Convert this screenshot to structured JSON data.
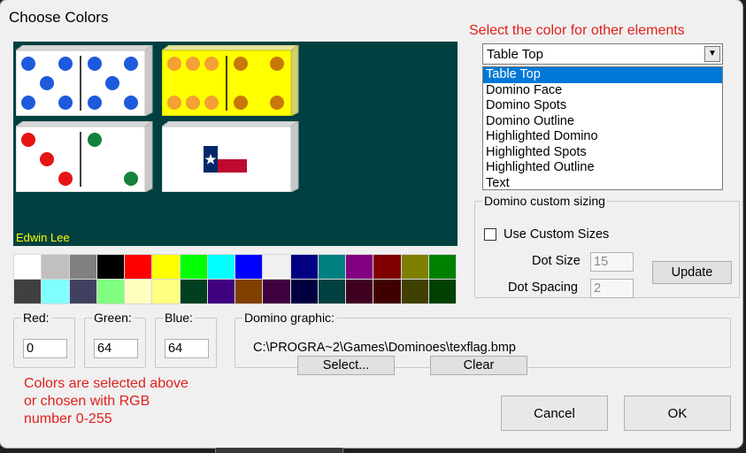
{
  "window": {
    "title": "Choose Colors"
  },
  "hints": {
    "element_select": "Select the color for other elements",
    "rgb_info": "Colors are selected above or chosen with RGB number 0-255"
  },
  "preview": {
    "credit": "Edwin Lee",
    "background": "#004040"
  },
  "palette": {
    "colors": [
      "#ffffff",
      "#c0c0c0",
      "#808080",
      "#000000",
      "#ff0000",
      "#ffff00",
      "#00ff00",
      "#00ffff",
      "#0000ff",
      "#f0f0f0",
      "#000080",
      "#008080",
      "#800080",
      "#800000",
      "#808000",
      "#008000",
      "#404040",
      "#80ffff",
      "#404060",
      "#80ff80",
      "#ffffc0",
      "#ffff80",
      "#004020",
      "#400080",
      "#804000",
      "#400040",
      "#000040",
      "#004040",
      "#400020",
      "#400000",
      "#404000",
      "#004000"
    ]
  },
  "element_selector": {
    "selected": "Table Top",
    "options": [
      "Table Top",
      "Domino Face",
      "Domino Spots",
      "Domino Outline",
      "Highlighted Domino",
      "Highlighted Spots",
      "Highlighted Outline",
      "Text"
    ]
  },
  "custom_sizing": {
    "legend": "Domino custom sizing",
    "checkbox_label": "Use Custom Sizes",
    "dot_size_label": "Dot Size",
    "dot_size_value": "15",
    "dot_spacing_label": "Dot Spacing",
    "dot_spacing_value": "2",
    "update_label": "Update"
  },
  "rgb": {
    "red_label": "Red:",
    "red_value": "0",
    "green_label": "Green:",
    "green_value": "64",
    "blue_label": "Blue:",
    "blue_value": "64"
  },
  "graphic": {
    "legend": "Domino graphic:",
    "path": "C:\\PROGRA~2\\Games\\Dominoes\\texflag.bmp",
    "select_label": "Select...",
    "clear_label": "Clear"
  },
  "buttons": {
    "cancel": "Cancel",
    "ok": "OK"
  },
  "colors": {
    "hint_red": "#e0201b",
    "credit_yellow": "#ffff00",
    "selection_blue": "#0078d7",
    "spot_blue": "#1e5adc",
    "spot_red": "#e61414",
    "spot_green": "#14823c",
    "highlight_face": "#ffff00",
    "highlight_spot_orange": "#f5a032",
    "highlight_spot_brown": "#c8780a"
  }
}
